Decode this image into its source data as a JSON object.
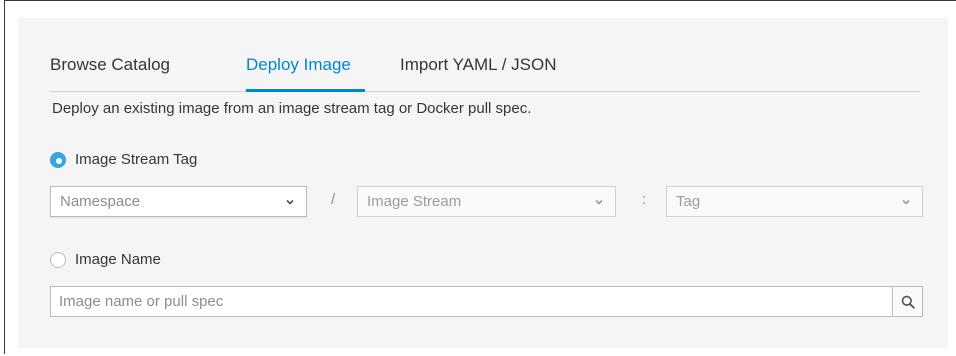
{
  "tabs": [
    {
      "label": "Browse Catalog",
      "active": false
    },
    {
      "label": "Deploy Image",
      "active": true
    },
    {
      "label": "Import YAML / JSON",
      "active": false
    }
  ],
  "description": "Deploy an existing image from an image stream tag or Docker pull spec.",
  "options": {
    "image_stream_tag": {
      "label": "Image Stream Tag",
      "checked": true
    },
    "image_name": {
      "label": "Image Name",
      "checked": false
    }
  },
  "selects": {
    "namespace": {
      "placeholder": "Namespace"
    },
    "image_stream": {
      "placeholder": "Image Stream"
    },
    "tag": {
      "placeholder": "Tag"
    }
  },
  "separators": {
    "slash": "/",
    "colon": ":"
  },
  "image_name_input": {
    "placeholder": "Image name or pull spec",
    "value": ""
  },
  "icons": {
    "chevron": "chevron-down-icon",
    "search": "search-icon"
  },
  "colors": {
    "accent": "#0088ce",
    "radio_checked": "#39a5dc",
    "panel": "#f5f5f5"
  }
}
